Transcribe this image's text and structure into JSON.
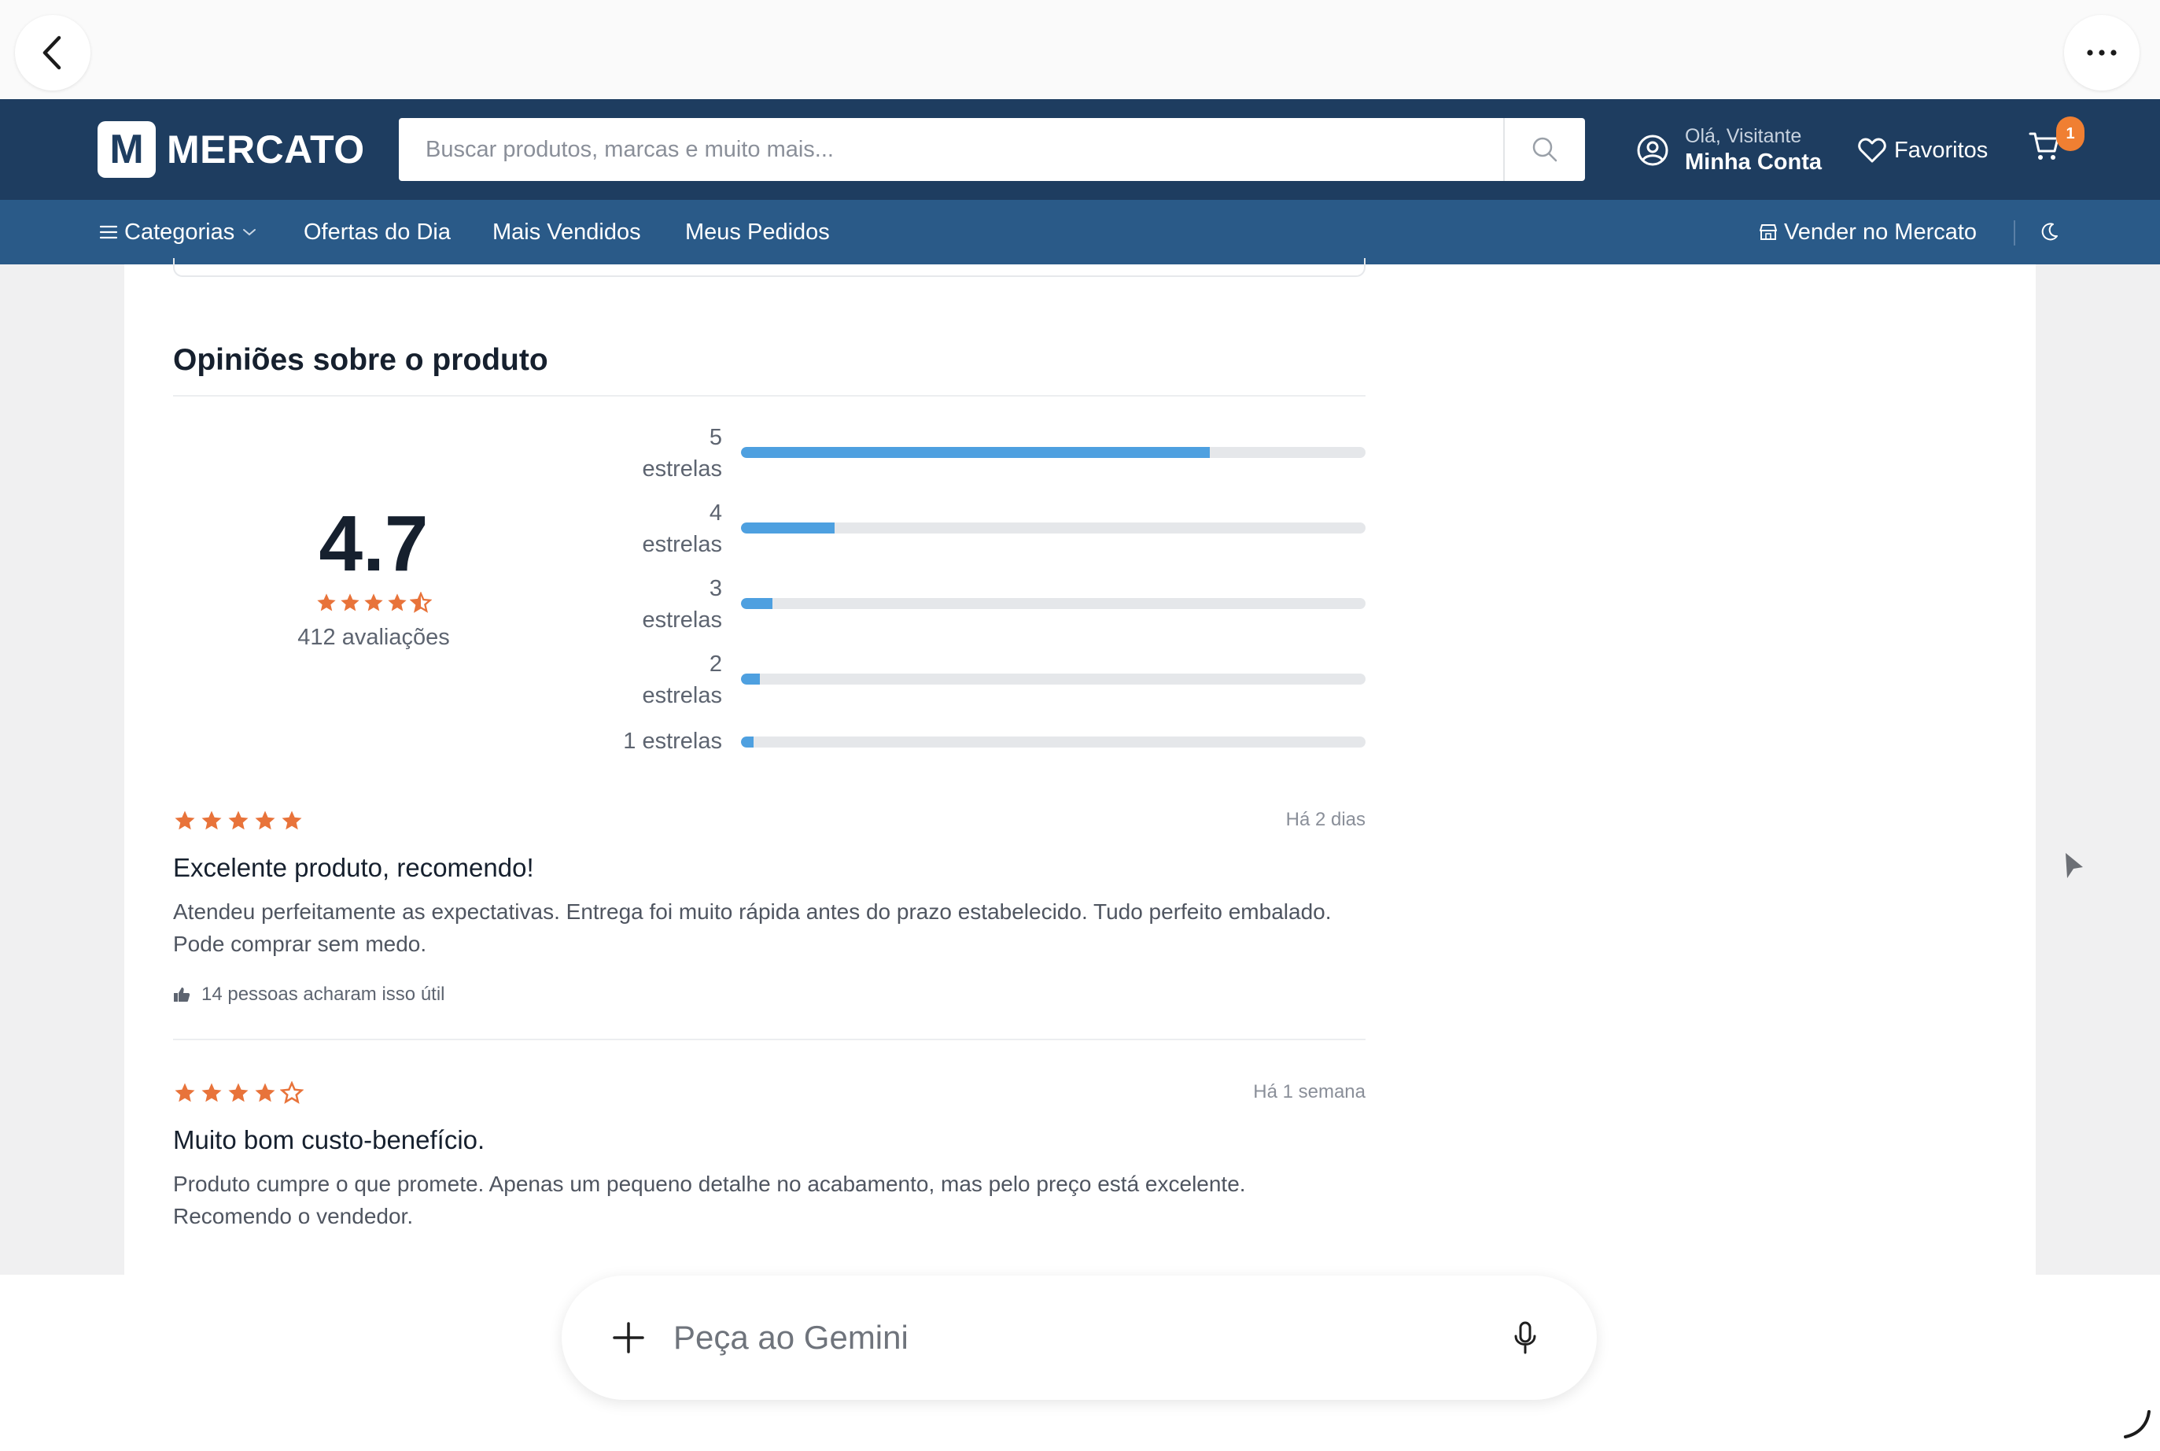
{
  "header": {
    "logo_letter": "M",
    "logo_text": "MERCATO",
    "search_placeholder": "Buscar produtos, marcas e muito mais...",
    "greeting": "Olá, Visitante",
    "account_label": "Minha Conta",
    "favorites_label": "Favoritos",
    "cart_count": "1"
  },
  "nav": {
    "categories": "Categorias",
    "offers": "Ofertas do Dia",
    "best_sellers": "Mais Vendidos",
    "orders": "Meus Pedidos",
    "sell": "Vender no Mercato"
  },
  "reviews": {
    "title": "Opiniões sobre o produto",
    "average": "4.7",
    "average_stars": 4.5,
    "count_label": "412 avaliações",
    "distribution": [
      {
        "label_num": "5",
        "label_word": "estrelas",
        "fraction": 0.75
      },
      {
        "label_num": "4",
        "label_word": "estrelas",
        "fraction": 0.15
      },
      {
        "label_num": "3",
        "label_word": "estrelas",
        "fraction": 0.05
      },
      {
        "label_num": "2",
        "label_word": "estrelas",
        "fraction": 0.03
      },
      {
        "label_num": "1 estrelas",
        "label_word": "",
        "fraction": 0.02
      }
    ],
    "items": [
      {
        "stars": 5,
        "date": "Há 2 dias",
        "title": "Excelente produto, recomendo!",
        "body": "Atendeu perfeitamente as expectativas. Entrega foi muito rápida antes do prazo estabelecido. Tudo perfeito embalado. Pode comprar sem medo.",
        "helpful": "14 pessoas acharam isso útil"
      },
      {
        "stars": 4,
        "date": "Há 1 semana",
        "title": "Muito bom custo-benefício.",
        "body": "Produto cumpre o que promete. Apenas um pequeno detalhe no acabamento, mas pelo preço está excelente. Recomendo o vendedor."
      }
    ]
  },
  "gemini": {
    "placeholder": "Peça ao Gemini"
  },
  "colors": {
    "header_bg": "#1e3d60",
    "nav_bg": "#2a5a88",
    "star": "#e8733a",
    "bar_fill": "#4ea0e0",
    "badge": "#f07f32"
  },
  "icons": [
    "back-icon",
    "more-icon",
    "search-icon",
    "user-icon",
    "heart-icon",
    "cart-icon",
    "menu-icon",
    "chevron-down-icon",
    "store-icon",
    "moon-icon",
    "thumbs-up-icon",
    "plus-icon",
    "mic-icon",
    "cursor-icon"
  ]
}
